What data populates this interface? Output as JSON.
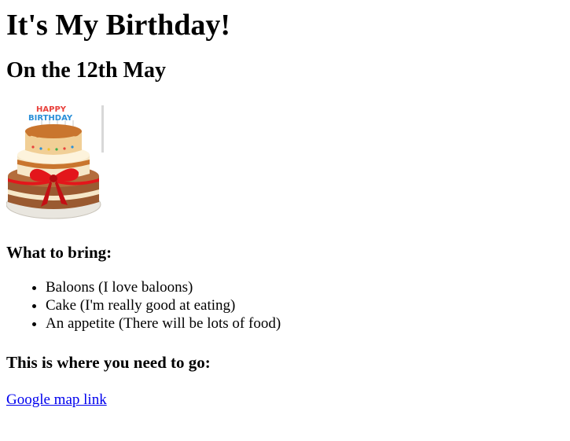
{
  "heading": "It's My Birthday!",
  "subheading": "On the 12th May",
  "cake_image": {
    "topper_line1": "HAPPY",
    "topper_line2": "BIRTHDAY",
    "colors": {
      "frosting": "#c9752e",
      "cream": "#f6e7c8",
      "ribbon": "#e3161b",
      "plate": "#e9e6df",
      "cake_dark": "#9a5a31"
    }
  },
  "bring_heading": "What to bring:",
  "bring_items": [
    "Baloons (I love baloons)",
    "Cake (I'm really good at eating)",
    "An appetite (There will be lots of food)"
  ],
  "go_heading": "This is where you need to go:",
  "map_link": "Google map link"
}
